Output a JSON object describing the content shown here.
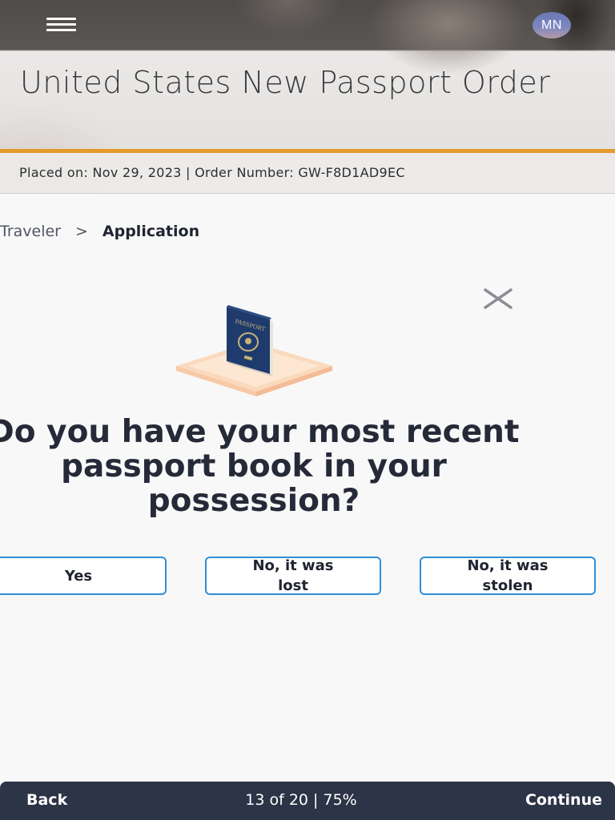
{
  "header": {
    "menu_icon": "hamburger-menu-icon",
    "avatar_initials": "MN",
    "title": "United States New Passport Order",
    "order_meta": "Placed on: Nov 29, 2023 | Order Number: GW-F8D1AD9EC",
    "accent_color": "#e39b2a"
  },
  "breadcrumb": {
    "previous": "Traveler",
    "separator": ">",
    "current": "Application"
  },
  "dialog": {
    "close_icon": "close-icon",
    "illustration": "passport-illustration",
    "illustration_text": "PASSPORT",
    "question": "Do you have your most recent passport book in your possession?",
    "choices": [
      {
        "label": "Yes"
      },
      {
        "label": "No, it was lost"
      },
      {
        "label": "No, it was stolen"
      }
    ],
    "choice_border_color": "#2f8fd6"
  },
  "footer": {
    "back_label": "Back",
    "progress_label": "13 of 20 | 75%",
    "continue_label": "Continue",
    "bar_color": "#2c3447"
  }
}
